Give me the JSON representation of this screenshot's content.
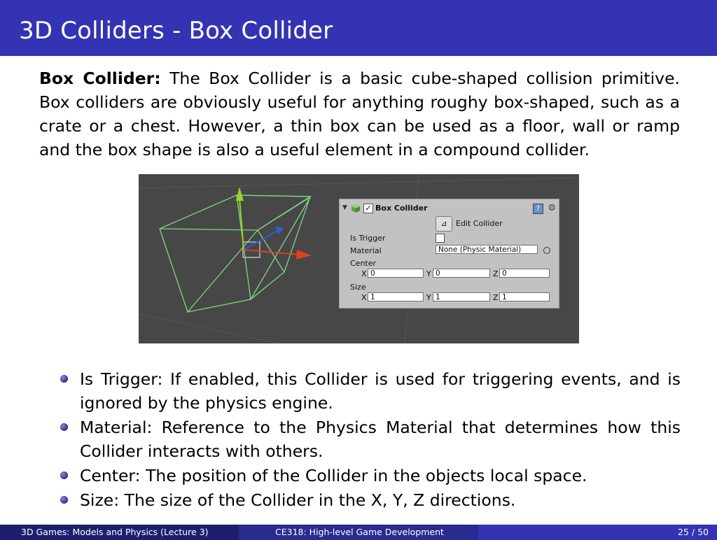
{
  "slide": {
    "title": "3D Colliders - Box Collider",
    "intro_bold": "Box Collider:",
    "intro_text": " The Box Collider is a basic cube-shaped collision primitive. Box colliders are obviously useful for anything roughy box-shaped, such as a crate or a chest. However, a thin box can be used as a floor, wall or ramp and the box shape is also a useful element in a compound collider."
  },
  "inspector": {
    "component_name": "Box Collider",
    "edit_collider_label": "Edit Collider",
    "is_trigger_label": "Is Trigger",
    "material_label": "Material",
    "material_value": "None (Physic Material)",
    "center_label": "Center",
    "size_label": "Size",
    "x_label": "X",
    "y_label": "Y",
    "z_label": "Z",
    "center": {
      "x": "0",
      "y": "0",
      "z": "0"
    },
    "size": {
      "x": "1",
      "y": "1",
      "z": "1"
    },
    "icons": [
      "foldout-arrow-icon",
      "cube-icon",
      "checkbox-icon",
      "help-icon",
      "gear-icon",
      "edit-collider-icon",
      "object-picker-icon"
    ]
  },
  "bullets": [
    "Is Trigger: If enabled, this Collider is used for triggering events, and is ignored by the physics engine.",
    "Material: Reference to the Physics Material that determines how this Collider interacts with others.",
    "Center: The position of the Collider in the objects local space.",
    "Size: The size of the Collider in the X, Y, Z directions."
  ],
  "footer": {
    "left": "3D Games: Models and Physics (Lecture 3)",
    "center": "CE318: High-level Game Development",
    "page": "25 / 50"
  },
  "colors": {
    "title_bar": "#3333b3",
    "collider_wire": "#7fd67f",
    "x_axis": "#e04020",
    "y_axis": "#9ad030",
    "z_axis": "#3060d0"
  }
}
